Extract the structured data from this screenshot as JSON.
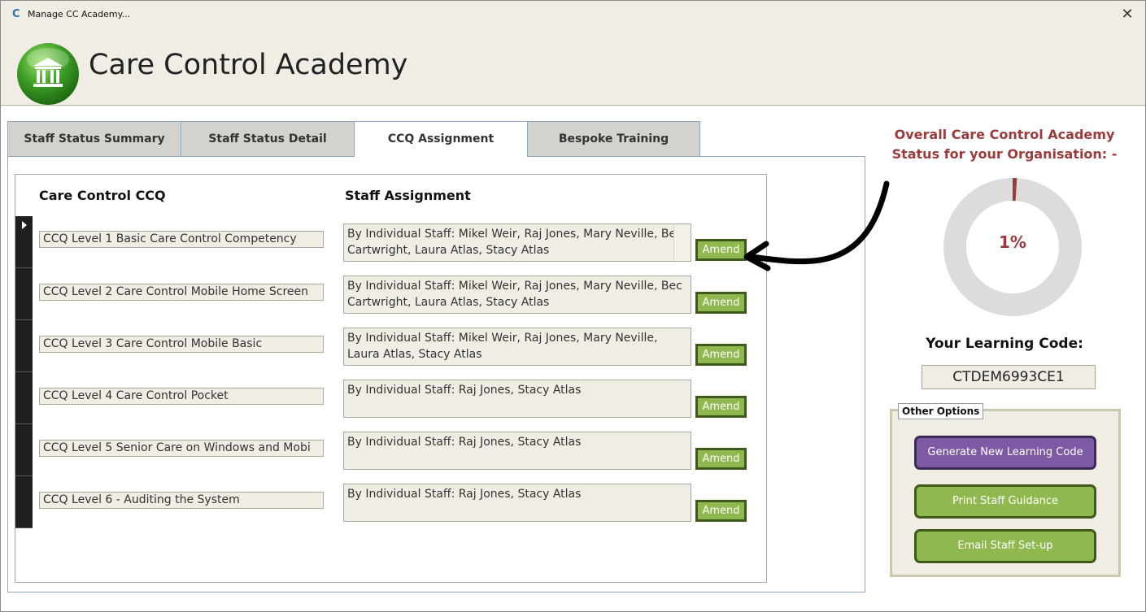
{
  "window": {
    "title": "Manage CC Academy...",
    "close_symbol": "✕"
  },
  "header": {
    "title": "Care Control Academy",
    "logo_icon": "academy-building-icon"
  },
  "tabs": [
    {
      "label": "Staff Status Summary",
      "active": false
    },
    {
      "label": "Staff Status Detail",
      "active": false
    },
    {
      "label": "CCQ Assignment",
      "active": true
    },
    {
      "label": "Bespoke Training",
      "active": false
    }
  ],
  "columns": {
    "ccq": "Care Control CCQ",
    "assignment": "Staff Assignment"
  },
  "rows": [
    {
      "ccq": "CCQ Level 1 Basic Care Control Competency",
      "assignment": "By Individual Staff:  Mikel Weir, Raj Jones, Mary Neville, Bec Cartwright, Laura Atlas, Stacy Atlas",
      "amend": "Amend"
    },
    {
      "ccq": "CCQ Level 2 Care Control Mobile Home Screen",
      "assignment": "By Individual Staff:  Mikel Weir, Raj Jones, Mary Neville, Bec Cartwright, Laura Atlas, Stacy Atlas",
      "amend": "Amend"
    },
    {
      "ccq": "CCQ Level 3 Care Control Mobile Basic",
      "assignment": "By Individual Staff:  Mikel Weir, Raj Jones, Mary Neville, Laura Atlas, Stacy Atlas",
      "amend": "Amend"
    },
    {
      "ccq": "CCQ Level 4 Care Control Pocket",
      "assignment": "By Individual Staff:  Raj Jones, Stacy Atlas",
      "amend": "Amend"
    },
    {
      "ccq": "CCQ Level 5 Senior Care on Windows and Mobi",
      "assignment": "By Individual Staff:  Raj Jones, Stacy Atlas",
      "amend": "Amend"
    },
    {
      "ccq": "CCQ Level 6 - Auditing the System",
      "assignment": "By Individual Staff:  Raj Jones, Stacy Atlas",
      "amend": "Amend"
    }
  ],
  "status": {
    "title": "Overall Care Control Academy Status for your Organisation: -",
    "percent_label": "1%",
    "percent_value": 1
  },
  "learning": {
    "label": "Your Learning Code:",
    "code": "CTDEM6993CE1"
  },
  "options": {
    "legend": "Other Options",
    "generate": "Generate New Learning Code",
    "print": "Print Staff Guidance",
    "email": "Email Staff Set-up"
  },
  "colors": {
    "accent_green": "#8fb84e",
    "purple": "#7d5aa3",
    "status_red": "#9b3b3b",
    "panel_beige": "#f0ede4"
  }
}
